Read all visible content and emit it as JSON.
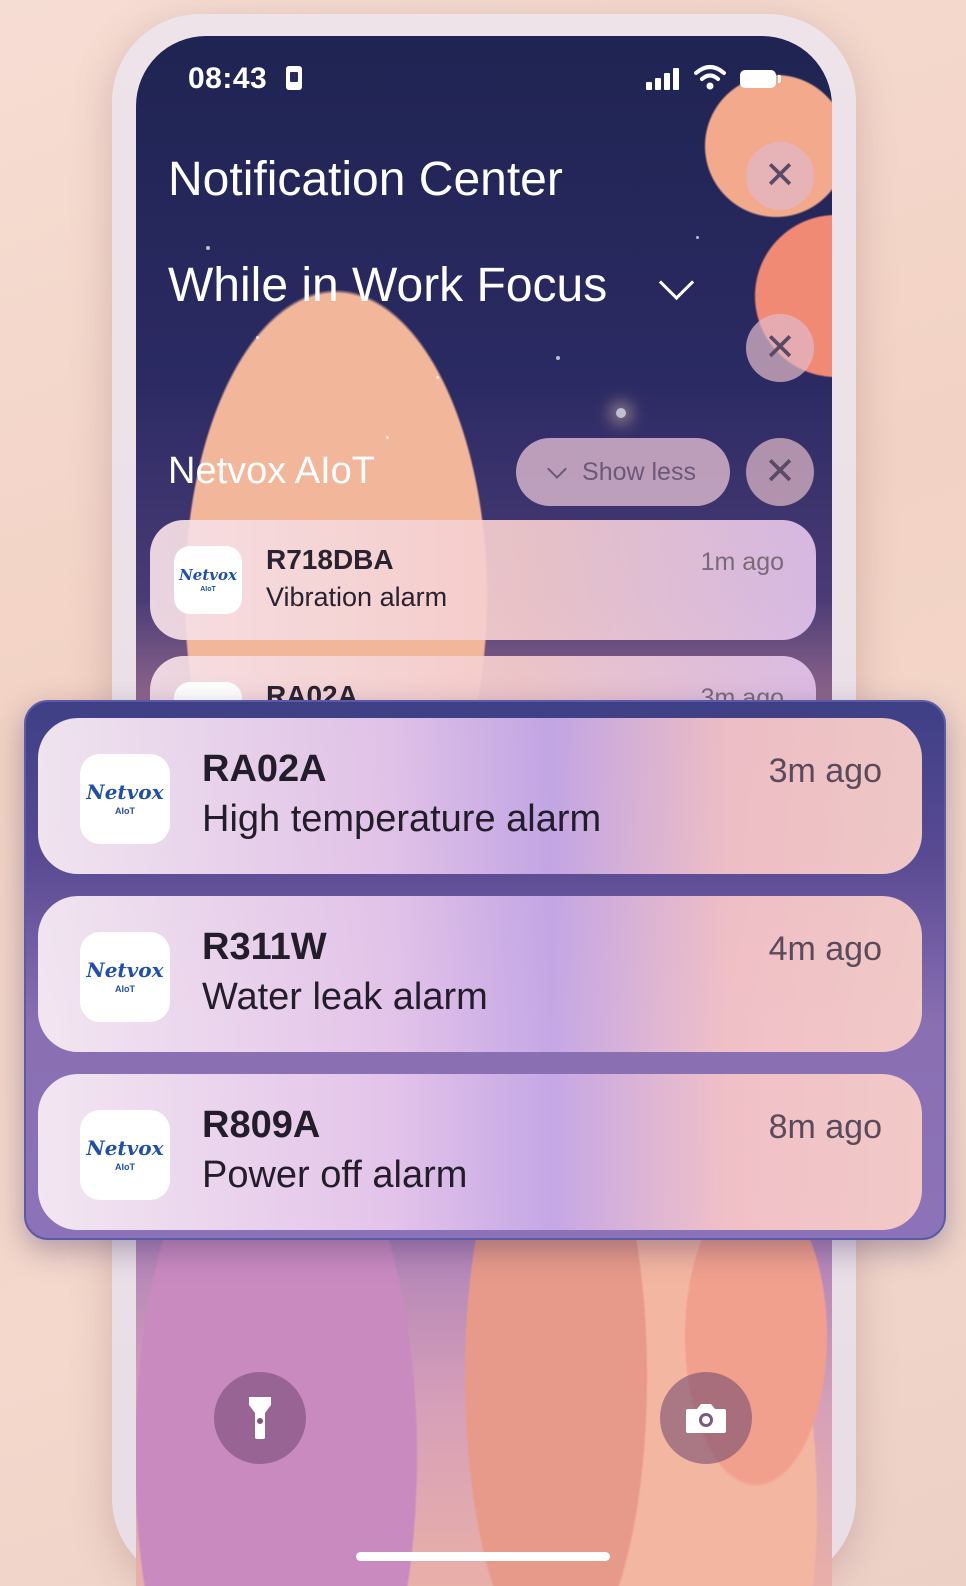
{
  "status_bar": {
    "time": "08:43"
  },
  "header": {
    "title": "Notification Center",
    "focus_label": "While in Work Focus",
    "close_symbol": "✕"
  },
  "group": {
    "app_name": "Netvox AIoT",
    "show_less_label": "Show less"
  },
  "app_logo": {
    "text": "Netvox",
    "sub": "AIoT"
  },
  "notifications_background": [
    {
      "device": "R718DBA",
      "message": "Vibration alarm",
      "time": "1m ago"
    },
    {
      "device": "RA02A",
      "message": "",
      "time": "3m ago"
    }
  ],
  "notifications_highlight": [
    {
      "device": "RA02A",
      "message": "High temperature alarm",
      "time": "3m ago"
    },
    {
      "device": "R311W",
      "message": "Water leak alarm",
      "time": "4m ago"
    },
    {
      "device": "R809A",
      "message": "Power off alarm",
      "time": "8m ago"
    }
  ],
  "quick_actions": {
    "left_icon": "flashlight-icon",
    "right_icon": "camera-icon"
  },
  "colors": {
    "logo_blue": "#1f4fa8",
    "accent_orange": "#e8572a",
    "close_button": "#e1b9c8"
  }
}
